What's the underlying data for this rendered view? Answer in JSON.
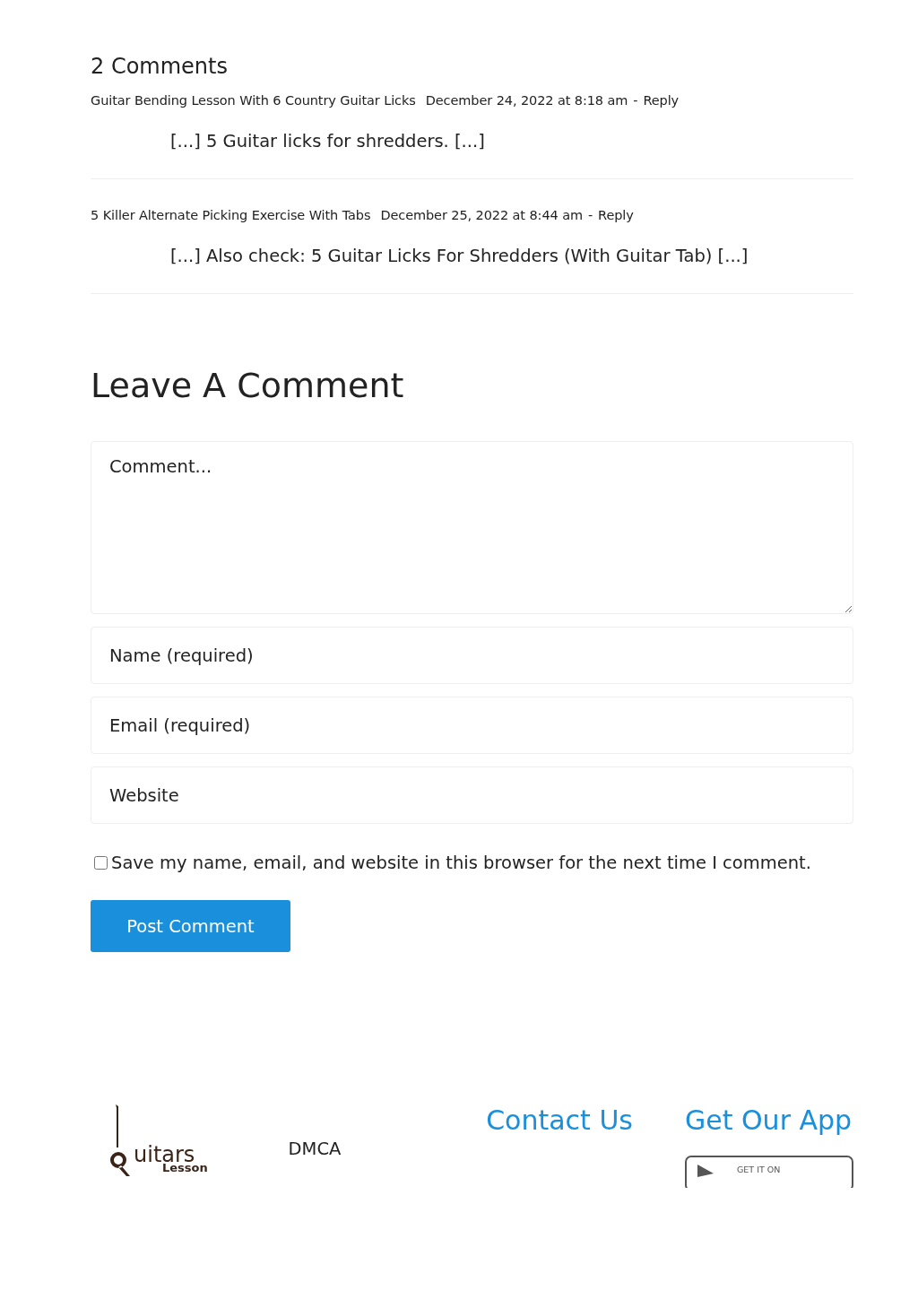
{
  "comments_title": "2 Comments",
  "comments": [
    {
      "author": "Guitar Bending Lesson With 6 Country Guitar Licks",
      "date": "December 24, 2022 at 8:18 am",
      "separator": "-",
      "reply": "Reply",
      "text": "[...] 5 Guitar licks for shredders. [...]"
    },
    {
      "author": "5 Killer Alternate Picking Exercise With Tabs",
      "date": "December 25, 2022 at 8:44 am",
      "separator": "-",
      "reply": "Reply",
      "text": "[...] Also check: 5 Guitar Licks For Shredders (With Guitar Tab) [...]"
    }
  ],
  "form": {
    "title": "Leave A Comment",
    "comment": {
      "placeholder": "Comment..."
    },
    "fields": [
      {
        "placeholder": "Name (required)"
      },
      {
        "placeholder": "Email (required)"
      },
      {
        "placeholder": "Website"
      }
    ],
    "consent": {
      "label": "Save my name, email, and website in this browser for the next time I comment.",
      "checked": false
    },
    "submit": "Post Comment"
  },
  "footer": {
    "logo": {
      "text": "uitars",
      "subtext": "Lesson"
    },
    "link": "DMCA",
    "contact": "Contact Us",
    "app": {
      "title": "Get Our App",
      "badge": "GET IT ON"
    }
  }
}
